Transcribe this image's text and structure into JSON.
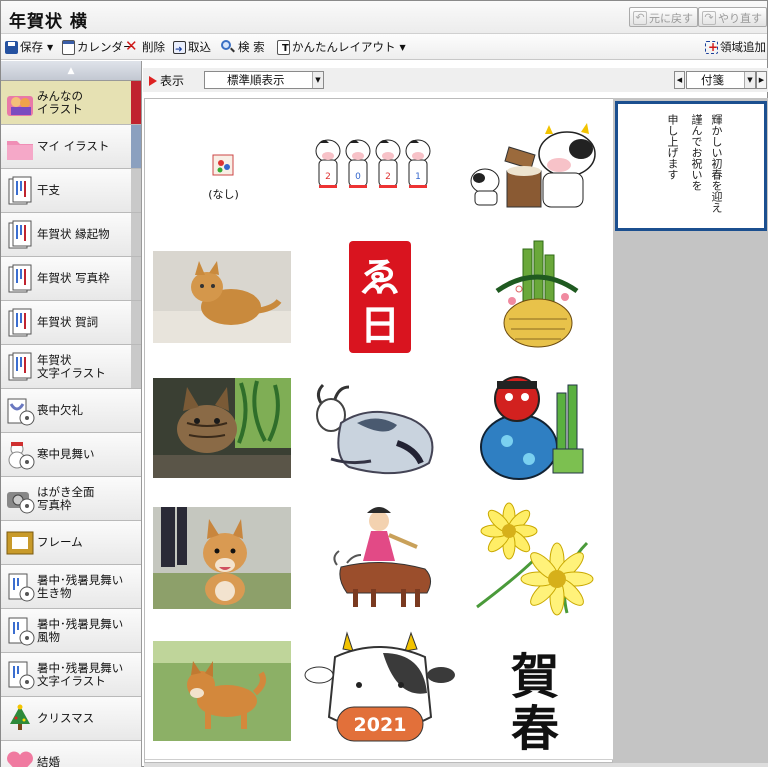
{
  "window": {
    "title": "年賀状 横"
  },
  "title_buttons": {
    "undo": "元に戻す",
    "redo": "やり直す"
  },
  "toolbar": {
    "save": "保存",
    "calendar": "カレンダー",
    "delete": "削除",
    "import": "取込",
    "search": "検 索",
    "easy_layout": "かんたんレイアウト",
    "add_area": "領域追加"
  },
  "filter": {
    "show_label": "表示",
    "sort_value": "標準順表示",
    "tag_value": "付箋"
  },
  "sidebar": {
    "items": [
      {
        "label": "みんなの\nイラスト",
        "icon": "people-folder-icon"
      },
      {
        "label": "マイ イラスト",
        "icon": "pink-folder-icon"
      },
      {
        "label": "干支",
        "icon": "card-stack-icon"
      },
      {
        "label": "年賀状 縁起物",
        "icon": "card-stack-icon"
      },
      {
        "label": "年賀状 写真枠",
        "icon": "card-stack-icon"
      },
      {
        "label": "年賀状 賀詞",
        "icon": "card-stack-icon"
      },
      {
        "label": "年賀状\n文字イラスト",
        "icon": "card-stack-icon"
      },
      {
        "label": "喪中欠礼",
        "icon": "mourning-disc-icon"
      },
      {
        "label": "寒中見舞い",
        "icon": "snowman-disc-icon"
      },
      {
        "label": "はがき全面\n写真枠",
        "icon": "camera-disc-icon"
      },
      {
        "label": "フレーム",
        "icon": "frame-icon"
      },
      {
        "label": "暑中･残暑見舞い\n生き物",
        "icon": "card-disc-icon"
      },
      {
        "label": "暑中･残暑見舞い\n風物",
        "icon": "card-disc-icon"
      },
      {
        "label": "暑中･残暑見舞い\n文字イラスト",
        "icon": "card-disc-icon"
      },
      {
        "label": "クリスマス",
        "icon": "xmas-tree-icon"
      },
      {
        "label": "結婚",
        "icon": "heart-icon"
      }
    ]
  },
  "grid": {
    "none_label": "(なし)",
    "cells": [
      {
        "name": "none-cell"
      },
      {
        "name": "cows-2021-cell"
      },
      {
        "name": "cow-mochi-cell"
      },
      {
        "name": "cat-photo-cell"
      },
      {
        "name": "ebisu-stamp-cell"
      },
      {
        "name": "kadomatsu-cell"
      },
      {
        "name": "kitten-photo-cell"
      },
      {
        "name": "ink-cow-cell"
      },
      {
        "name": "shishimai-cell"
      },
      {
        "name": "shiba-puppy-photo-cell"
      },
      {
        "name": "goddess-ox-cell"
      },
      {
        "name": "adonis-flower-cell"
      },
      {
        "name": "shiba-dog-photo-cell"
      },
      {
        "name": "cow-2021-cell"
      },
      {
        "name": "gashun-calligraphy-cell"
      }
    ],
    "year_text": "2021",
    "ebisu_text": "ゑ日",
    "gashun_text": "賀春",
    "cows_digits": [
      "2",
      "0",
      "2",
      "1"
    ]
  },
  "selected_card": {
    "lines": [
      "輝かしい初春を迎え",
      "謹んでお祝いを",
      "申し上げます"
    ]
  },
  "colors": {
    "accent_red": "#c0232f",
    "selection_blue": "#1b4f8f"
  }
}
